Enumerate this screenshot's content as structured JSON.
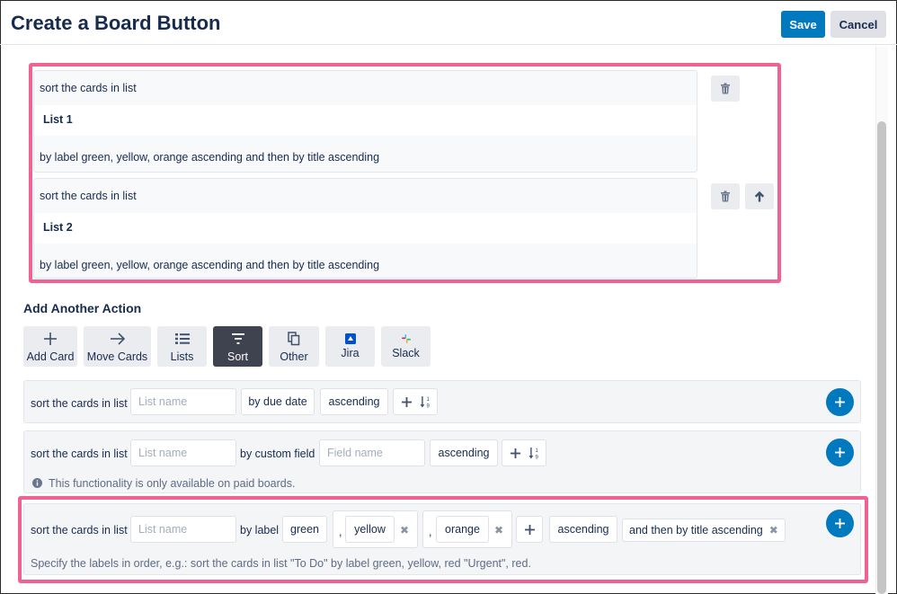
{
  "header": {
    "title": "Create a Board Button",
    "save_label": "Save",
    "cancel_label": "Cancel"
  },
  "saved_actions": [
    {
      "line1": "sort the cards in list",
      "list": "List 1",
      "line3": "by label green, yellow, orange ascending and then by title ascending"
    },
    {
      "line1": "sort the cards in list",
      "list": "List 2",
      "line3": "by label green, yellow, orange ascending and then by title ascending"
    }
  ],
  "add_action": {
    "title": "Add Another Action",
    "tiles": [
      "Add Card",
      "Move Cards",
      "Lists",
      "Sort",
      "Other",
      "Jira",
      "Slack"
    ],
    "active_tile": "Sort"
  },
  "rows": {
    "due": {
      "prefix": "sort the cards in list",
      "list_placeholder": "List name",
      "by": "by due date",
      "order": "ascending"
    },
    "custom": {
      "prefix": "sort the cards in list",
      "list_placeholder": "List name",
      "by": "by custom field",
      "field_placeholder": "Field name",
      "order": "ascending",
      "info": "This functionality is only available on paid boards."
    },
    "label": {
      "prefix": "sort the cards in list",
      "list_placeholder": "List name",
      "by": "by label",
      "labels": [
        "green",
        "yellow",
        "orange"
      ],
      "comma": ",",
      "order": "ascending",
      "then": "and then by title ascending",
      "hint": "Specify the labels in order, e.g.: sort the cards in list \"To Do\" by label green, yellow, red \"Urgent\", red."
    }
  },
  "colors": {
    "primary": "#0079bf",
    "highlight": "#f06292",
    "active_tile": "#3f4350"
  }
}
